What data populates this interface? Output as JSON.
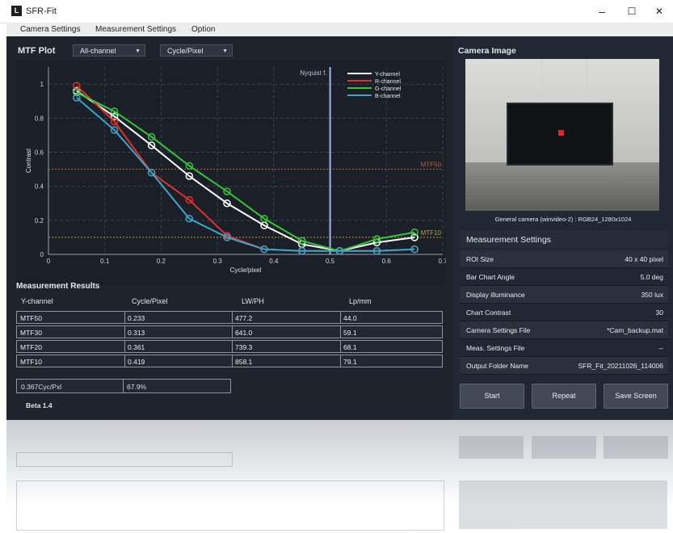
{
  "window": {
    "icon_letter": "L",
    "title": "SFR-Fit",
    "minimize": "–",
    "maximize": "☐",
    "close": "✕"
  },
  "menu": [
    "Camera Settings",
    "Measurement Settings",
    "Option"
  ],
  "mtf_plot": {
    "title": "MTF Plot",
    "channel_select": "All-channel",
    "unit_select": "Cycle/Pixel"
  },
  "chart_data": {
    "type": "line",
    "xlabel": "Cycle/pixel",
    "ylabel": "Contrast",
    "xlim": [
      0,
      0.7
    ],
    "ylim": [
      0,
      1.1
    ],
    "x_ticks": [
      "0",
      "0.1",
      "0.2",
      "0.3",
      "0.4",
      "0.5",
      "0.6",
      "0.7"
    ],
    "y_ticks": [
      "0",
      "0.2",
      "0.4",
      "0.6",
      "0.8",
      "1"
    ],
    "grid": true,
    "legend_placement": "top-right",
    "nyquist_label": "Nyquist f.",
    "nyquist_x": 0.5,
    "thresholds": [
      {
        "label": "MTF50",
        "y": 0.5,
        "color": "#b5623a"
      },
      {
        "label": "MTF10",
        "y": 0.1,
        "color": "#c49a32"
      }
    ],
    "x": [
      0.05,
      0.117,
      0.183,
      0.25,
      0.317,
      0.383,
      0.45,
      0.517,
      0.583,
      0.65
    ],
    "series": [
      {
        "name": "Y-channel",
        "color": "#ffffff",
        "values": [
          0.96,
          0.81,
          0.64,
          0.46,
          0.3,
          0.17,
          0.06,
          0.02,
          0.07,
          0.1
        ]
      },
      {
        "name": "R-channel",
        "color": "#e0302c",
        "values": [
          0.99,
          0.78,
          0.48,
          0.32,
          0.11,
          0.03,
          0.02,
          0.02,
          0.02,
          0.03
        ]
      },
      {
        "name": "G-channel",
        "color": "#35c43a",
        "values": [
          0.95,
          0.84,
          0.69,
          0.52,
          0.37,
          0.21,
          0.08,
          0.02,
          0.09,
          0.13
        ]
      },
      {
        "name": "B-channel",
        "color": "#3aa6c9",
        "values": [
          0.92,
          0.73,
          0.48,
          0.21,
          0.1,
          0.03,
          0.02,
          0.02,
          0.02,
          0.03
        ]
      }
    ]
  },
  "results": {
    "title": "Measurement Results",
    "headers": [
      "Y-channel",
      "Cycle/Pixel",
      "LW/PH",
      "Lp/mm"
    ],
    "rows": [
      [
        "MTF50",
        "0.233",
        "477.2",
        "44.0"
      ],
      [
        "MTF30",
        "0.313",
        "641.0",
        "59.1"
      ],
      [
        "MTF20",
        "0.361",
        "739.3",
        "68.1"
      ],
      [
        "MTF10",
        "0.419",
        "858.1",
        "79.1"
      ]
    ],
    "status_left": "0.367Cyc/Pxl",
    "status_right": "67.9%",
    "version": "Beta 1.4"
  },
  "camera": {
    "title": "Camera Image",
    "caption": "General camera (winvideo-2) : RGB24_1280x1024"
  },
  "settings": {
    "title": "Measurement Settings",
    "rows": [
      {
        "label": "ROI Size",
        "value": "40 x 40 pixel"
      },
      {
        "label": "Bar Chart Angle",
        "value": "5.0 deg"
      },
      {
        "label": "Display illuminance",
        "value": "350 lux"
      },
      {
        "label": "Chart Contrast",
        "value": "30"
      },
      {
        "label": "Camera Settings File",
        "value": "*Cam_backup.mat"
      },
      {
        "label": "Meas. Settings File",
        "value": "--"
      },
      {
        "label": "Output Folder Name",
        "value": "SFR_Fit_20211026_114006"
      }
    ]
  },
  "buttons": {
    "start": "Start",
    "repeat": "Repeat",
    "save": "Save Screen"
  }
}
